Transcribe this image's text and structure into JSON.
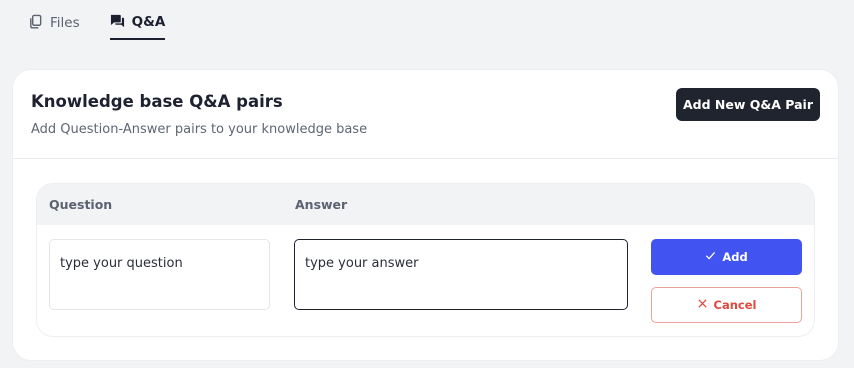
{
  "tabs": [
    {
      "label": "Files",
      "icon": "files-icon",
      "active": false
    },
    {
      "label": "Q&A",
      "icon": "chat-icon",
      "active": true
    }
  ],
  "card": {
    "title": "Knowledge base Q&A pairs",
    "subtitle": "Add Question-Answer pairs to your knowledge base",
    "add_button_label": "Add New Q&A Pair"
  },
  "table": {
    "columns": [
      "Question",
      "Answer"
    ],
    "question_placeholder": "type your question",
    "answer_placeholder": "type your answer",
    "add_label": "Add",
    "cancel_label": "Cancel"
  },
  "colors": {
    "primary": "#4154f1",
    "danger": "#e2483d",
    "dark_button": "#1f242e"
  }
}
